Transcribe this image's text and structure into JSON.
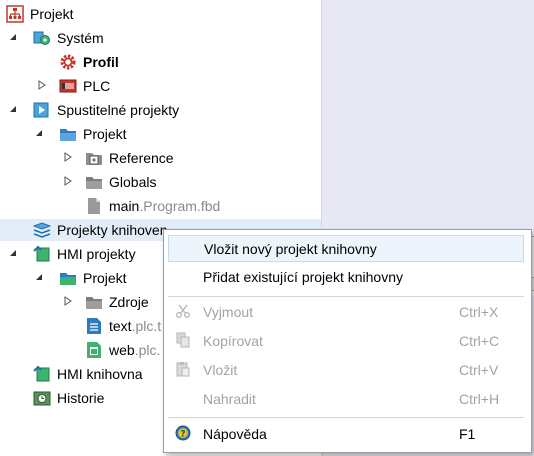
{
  "tree": {
    "nodes": [
      {
        "label": "Projekt"
      },
      {
        "label": "Systém"
      },
      {
        "label": "Profil"
      },
      {
        "label": "PLC"
      },
      {
        "label": "Spustitelné projekty"
      },
      {
        "label": "Projekt"
      },
      {
        "label": "Reference"
      },
      {
        "label": "Globals"
      },
      {
        "label": "main",
        "ext": ".Program.fbd"
      },
      {
        "label": "Projekty knihoven"
      },
      {
        "label": "HMI projekty"
      },
      {
        "label": "Projekt"
      },
      {
        "label": "Zdroje"
      },
      {
        "label": "text",
        "ext": ".plc.t"
      },
      {
        "label": "web",
        "ext": ".plc."
      },
      {
        "label": "HMI knihovna"
      },
      {
        "label": "Historie"
      }
    ]
  },
  "context_menu": {
    "items": [
      {
        "label": "Vložit nový projekt knihovny",
        "shortcut": ""
      },
      {
        "label": "Přidat existující projekt knihovny",
        "shortcut": ""
      },
      {
        "label": "Vyjmout",
        "shortcut": "Ctrl+X"
      },
      {
        "label": "Kopírovat",
        "shortcut": "Ctrl+C"
      },
      {
        "label": "Vložit",
        "shortcut": "Ctrl+V"
      },
      {
        "label": "Nahradit",
        "shortcut": "Ctrl+H"
      },
      {
        "label": "Nápověda",
        "shortcut": "F1"
      }
    ]
  }
}
